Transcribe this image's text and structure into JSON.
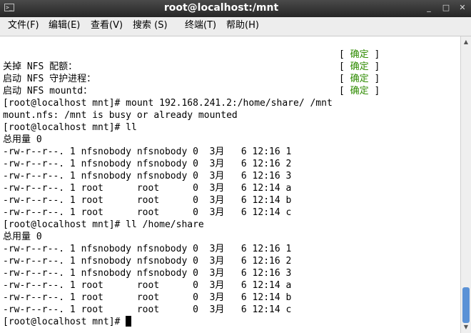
{
  "window": {
    "title": "root@localhost:/mnt",
    "icon": "terminal-icon",
    "controls": {
      "minimize": "_",
      "maximize": "□",
      "close": "✕"
    }
  },
  "menu": [
    {
      "label": "文件(F)",
      "name": "menu-file"
    },
    {
      "label": "编辑(E)",
      "name": "menu-edit"
    },
    {
      "label": "查看(V)",
      "name": "menu-view"
    },
    {
      "label": "搜索 (S)",
      "name": "menu-search"
    },
    {
      "label": "终端(T)",
      "name": "menu-terminal"
    },
    {
      "label": "帮助(H)",
      "name": "menu-help"
    }
  ],
  "terminal": {
    "status_lines": [
      {
        "label": "",
        "status": "确定"
      },
      {
        "label": "关掉 NFS 配额：",
        "status": "确定"
      },
      {
        "label": "启动 NFS 守护进程：",
        "status": "确定"
      },
      {
        "label": "启动 NFS mountd：",
        "status": "确定"
      }
    ],
    "lines": [
      "[root@localhost mnt]# mount 192.168.241.2:/home/share/ /mnt",
      "mount.nfs: /mnt is busy or already mounted",
      "[root@localhost mnt]# ll",
      "总用量 0",
      "-rw-r--r--. 1 nfsnobody nfsnobody 0  3月   6 12:16 1",
      "-rw-r--r--. 1 nfsnobody nfsnobody 0  3月   6 12:16 2",
      "-rw-r--r--. 1 nfsnobody nfsnobody 0  3月   6 12:16 3",
      "-rw-r--r--. 1 root      root      0  3月   6 12:14 a",
      "-rw-r--r--. 1 root      root      0  3月   6 12:14 b",
      "-rw-r--r--. 1 root      root      0  3月   6 12:14 c",
      "[root@localhost mnt]# ll /home/share",
      "总用量 0",
      "-rw-r--r--. 1 nfsnobody nfsnobody 0  3月   6 12:16 1",
      "-rw-r--r--. 1 nfsnobody nfsnobody 0  3月   6 12:16 2",
      "-rw-r--r--. 1 nfsnobody nfsnobody 0  3月   6 12:16 3",
      "-rw-r--r--. 1 root      root      0  3月   6 12:14 a",
      "-rw-r--r--. 1 root      root      0  3月   6 12:14 b",
      "-rw-r--r--. 1 root      root      0  3月   6 12:14 c"
    ],
    "prompt": "[root@localhost mnt]# "
  },
  "colors": {
    "ok": "#2e8b00",
    "scroll_thumb": "#5b92d6"
  }
}
